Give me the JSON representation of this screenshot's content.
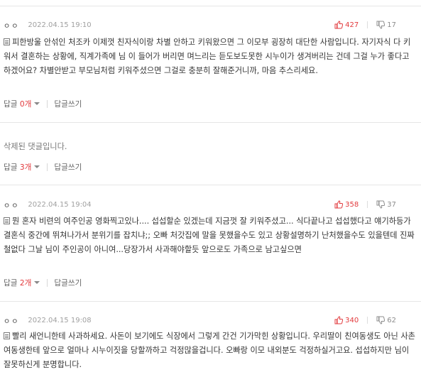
{
  "comments": [
    {
      "user": "ㅇㅇ",
      "date": "2022.04.15 19:10",
      "likes": "427",
      "dislikes": "17",
      "text": "피한방울 안섞인 처조카 이제껏 친자식이랑 차별 안하고 키워왔으면 그 이모부 굉장히 대단한 사람입니다. 자기자식 다 키워서 결혼하는 상황에, 직계가족에 님 이 들어가 버리면 며느리는 듣도보도못한 시누이가 생겨버리는 건데 그걸 누가 좋다고 하겠어요? 차별안받고 부모님처럼 키워주셨으면 그걸로 충분히 잘해준거니까, 마음 추스리세요.",
      "reply_label": "답글",
      "reply_count": "0개",
      "write_label": "답글쓰기"
    },
    {
      "deleted_text": "삭제된 댓글입니다.",
      "reply_label": "답글",
      "reply_count": "3개",
      "write_label": "답글쓰기"
    },
    {
      "user": "ㅇㅇ",
      "date": "2022.04.15 19:04",
      "likes": "358",
      "dislikes": "37",
      "text": "뭔 혼자 비련의 여주인공 영화찍고있나.... 섭섭할순 있겠는데 지금껏 잘 키워주셨고... 식다끝나고 섭섭했다고 얘기하등가 결혼식 중간에 뛰쳐나가서 분위기를 잡치냐;; 오빠 처갓집에 말을 못했을수도 있고 상황설명하기 난처했을수도 있을텐데 진짜 철없다 그날 님이 주인공이 아니여...당장가서 사과해야할듯 앞으로도 가족으로 남고싶으면",
      "reply_label": "답글",
      "reply_count": "2개",
      "write_label": "답글쓰기"
    },
    {
      "user": "ㅇㅇ",
      "date": "2022.04.15 19:08",
      "likes": "340",
      "dislikes": "62",
      "text": "빨리 새언니한테 사과하세요. 사돈이 보기에도 식장에서 그렇게 간건 기가막힌 상황입니다. 우리딸이 친여동생도 아닌 사촌 여동생한테 앞으로 얼마나 시누이짓을 당할까하고 걱정많을겁니다. 오빠랑 이모 내외분도 걱정하실거고요. 섭섭하지만 님이 잘못하신게 분명합니다."
    }
  ],
  "colors": {
    "like": "#e2393c",
    "reply_count": "#e2393c",
    "muted": "#999999"
  },
  "icons": {
    "like": "thumbs-up-icon",
    "dislike": "thumbs-down-icon",
    "text": "document-icon",
    "dropdown": "chevron-down-icon"
  }
}
